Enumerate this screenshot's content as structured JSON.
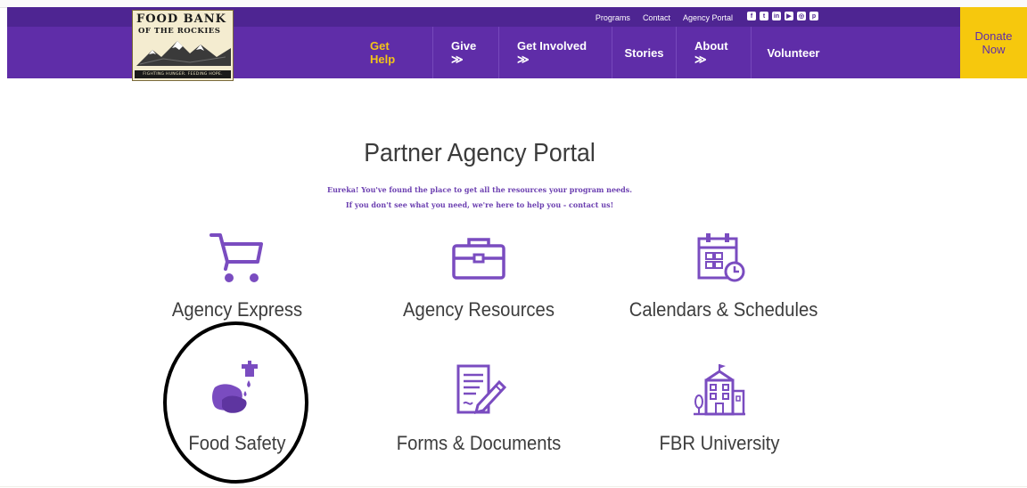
{
  "header": {
    "logo": {
      "line1": "Food Bank",
      "line2": "of the Rockies",
      "tagline": "Fighting Hunger. Feeding Hope."
    },
    "utility_links": [
      "Programs",
      "Contact",
      "Agency Portal"
    ],
    "social_icons": [
      "facebook-icon",
      "twitter-icon",
      "linkedin-icon",
      "youtube-icon",
      "instagram-icon",
      "pinterest-icon"
    ],
    "nav": [
      {
        "label": "Get Help",
        "active": true
      },
      {
        "label": "Give ≫",
        "active": false
      },
      {
        "label": "Get Involved ≫",
        "active": false
      },
      {
        "label": "Stories",
        "active": false
      },
      {
        "label": "About ≫",
        "active": false
      },
      {
        "label": "Volunteer",
        "active": false
      }
    ],
    "donate": {
      "line1": "Donate",
      "line2": "Now"
    }
  },
  "main": {
    "title": "Partner Agency Portal",
    "intro_line1": "Eureka! You've found the place to get all the resources your program needs.",
    "intro_line2": "If you don't see what you need, we're here to help you - contact us!",
    "tiles": [
      {
        "label": "Agency Express",
        "icon": "shopping-cart-icon"
      },
      {
        "label": "Agency Resources",
        "icon": "briefcase-icon"
      },
      {
        "label": "Calendars & Schedules",
        "icon": "calendar-icon"
      },
      {
        "label": "Food Safety",
        "icon": "hand-washing-icon"
      },
      {
        "label": "Forms & Documents",
        "icon": "document-icon"
      },
      {
        "label": "FBR University",
        "icon": "school-building-icon"
      }
    ]
  },
  "colors": {
    "brand_purple": "#5f2da8",
    "active_nav": "#f2c418",
    "donate_yellow": "#f6c80d",
    "icon_purple": "#7a4cc0"
  }
}
